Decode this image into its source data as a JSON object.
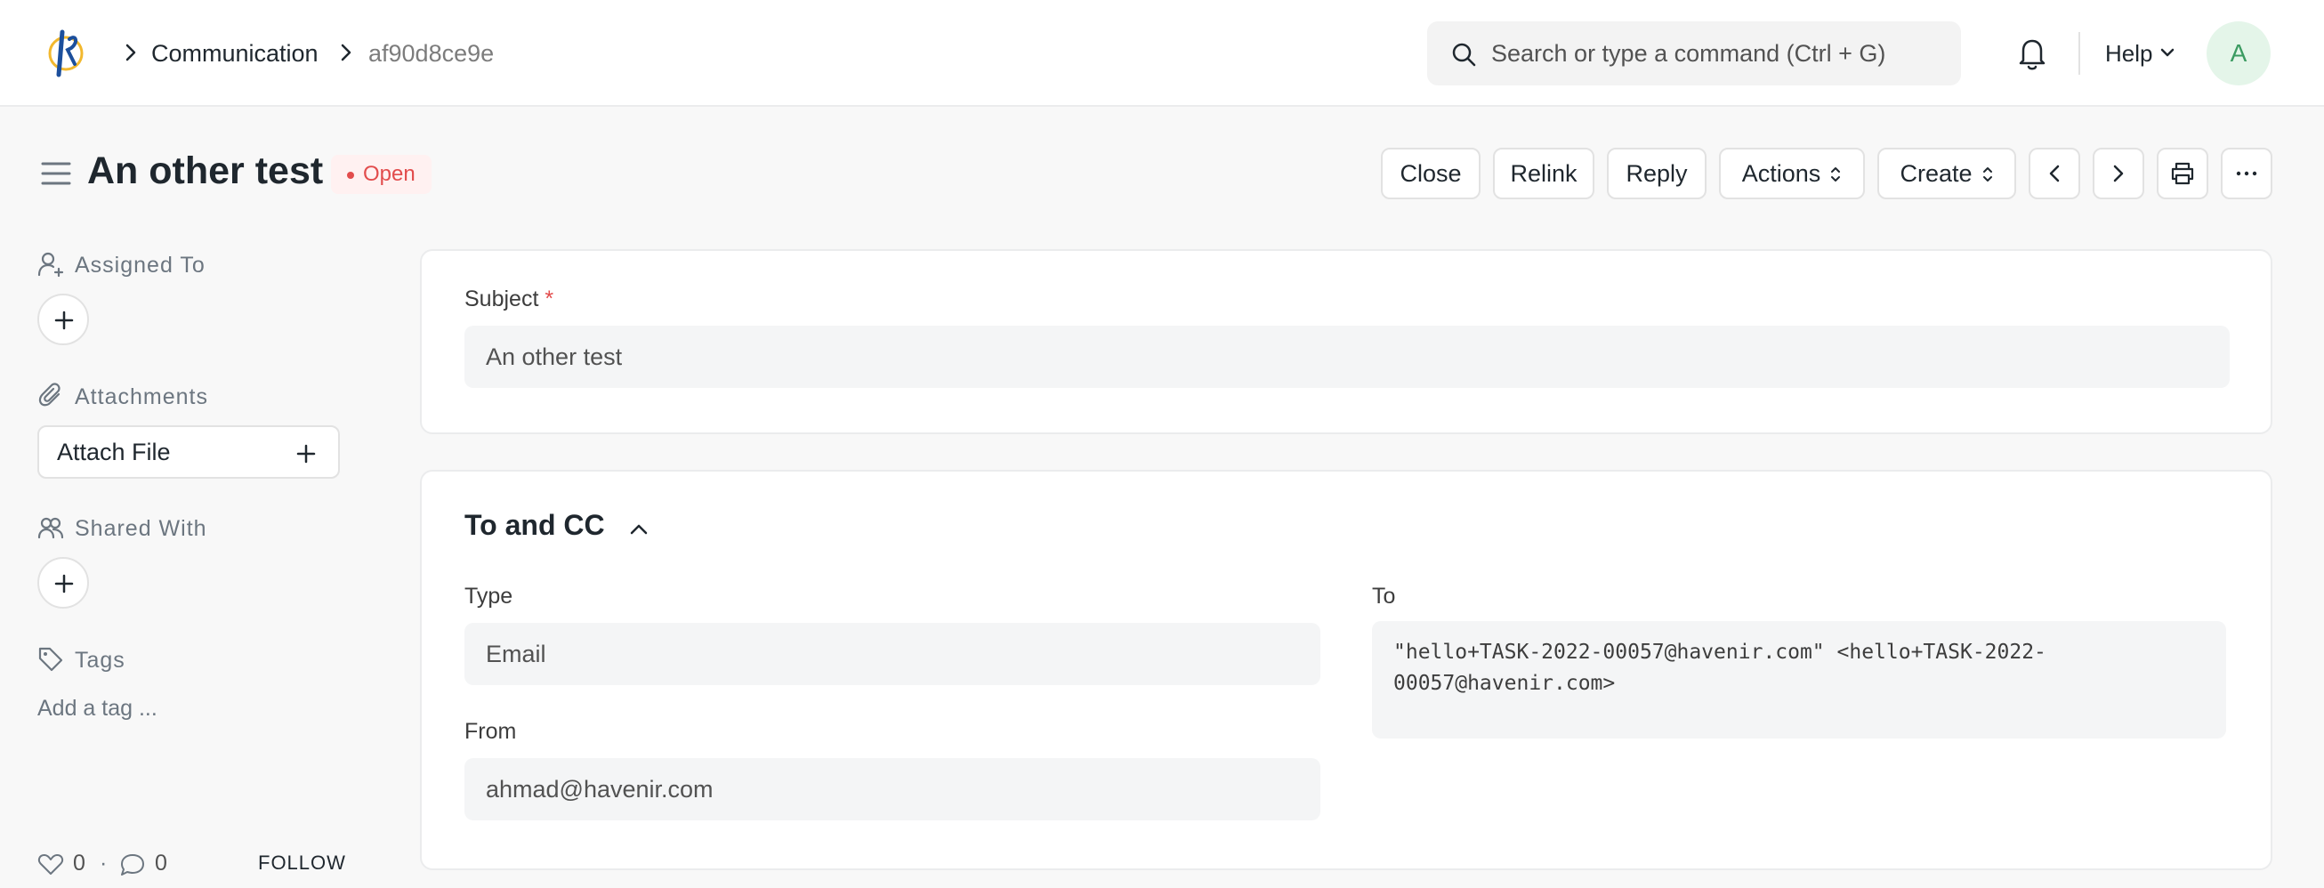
{
  "navbar": {
    "breadcrumbs": [
      "Communication",
      "af90d8ce9e"
    ],
    "search_placeholder": "Search or type a command (Ctrl + G)",
    "help_label": "Help",
    "avatar_initial": "A"
  },
  "page": {
    "title": "An other test",
    "status": "Open"
  },
  "toolbar": {
    "close": "Close",
    "relink": "Relink",
    "reply": "Reply",
    "actions": "Actions",
    "create": "Create"
  },
  "sidebar": {
    "assigned_to": "Assigned To",
    "attachments": "Attachments",
    "attach_file": "Attach File",
    "shared_with": "Shared With",
    "tags": "Tags",
    "add_tag": "Add a tag ...",
    "likes": "0",
    "comments": "0",
    "follow": "FOLLOW"
  },
  "form": {
    "subject_label": "Subject",
    "subject_required": "*",
    "subject_value": "An other test",
    "section_title": "To and CC",
    "type_label": "Type",
    "type_value": "Email",
    "from_label": "From",
    "from_value": "ahmad@havenir.com",
    "to_label": "To",
    "to_value": "\"hello+TASK-2022-00057@havenir.com\" <hello+TASK-2022-00057@havenir.com>"
  },
  "colors": {
    "status_red": "#e24c4c",
    "avatar_green": "#3b9b61"
  }
}
